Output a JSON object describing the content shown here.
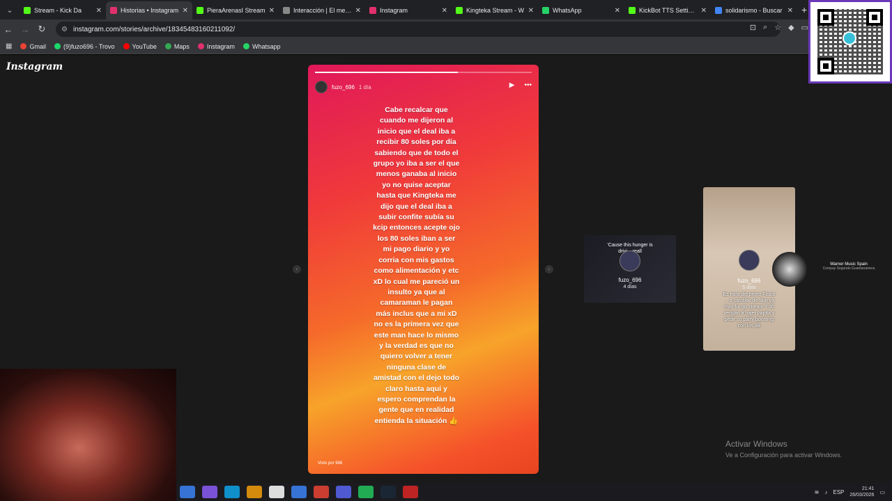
{
  "browser": {
    "tabs": [
      {
        "label": "Stream - Kick Da",
        "color": "#53fc18",
        "active": false
      },
      {
        "label": "Historias • Instagram",
        "color": "#e1306c",
        "active": true
      },
      {
        "label": "PieraArenasI Stream",
        "color": "#53fc18",
        "active": false
      },
      {
        "label": "Interacción | El mejor",
        "color": "#888888",
        "active": false
      },
      {
        "label": "Instagram",
        "color": "#e1306c",
        "active": false
      },
      {
        "label": "Kingteka Stream - W",
        "color": "#53fc18",
        "active": false
      },
      {
        "label": "WhatsApp",
        "color": "#25d366",
        "active": false
      },
      {
        "label": "KickBot TTS Settings",
        "color": "#53fc18",
        "active": false
      },
      {
        "label": "solidarismo - Buscar",
        "color": "#4285f4",
        "active": false
      }
    ],
    "url": "instagram.com/stories/archive/18345483160211092/",
    "bookmarks": [
      {
        "label": "Gmail",
        "color": "#ea4335"
      },
      {
        "label": "(9)fuzo696 - Trovo",
        "color": "#1bd96a"
      },
      {
        "label": "YouTube",
        "color": "#ff0000"
      },
      {
        "label": "Maps",
        "color": "#34a853"
      },
      {
        "label": "Instagram",
        "color": "#e1306c"
      },
      {
        "label": "Whatsapp",
        "color": "#25d366"
      }
    ]
  },
  "page": {
    "logo": "Instagram",
    "story": {
      "progress": 0.66,
      "username": "fuzo_696",
      "time": "1 día",
      "text": "Cabe recalcar que\ncuando me dijeron al\ninicio que el deal iba a\nrecibir 80 soles por día\nsabiendo que de todo el\ngrupo yo iba a ser el que\nmenos ganaba al inicio\nyo no quise aceptar\nhasta que Kingteka me\ndijo que el deal iba a\nsubir confite subía su\nkcip entonces acepte ojo\nlos 80 soles iban a ser\nmi pago diario y yo\ncorria con mis gastos\ncomo alimentación y etc\nxD lo cual me pareció un\ninsulto ya que al\ncamaraman le pagan\nmás inclus que a mi  xD\nno es la primera vez que\neste man hace lo mismo\ny la verdad es que no\nquiero volver a tener\nninguna clase de\namistad con el  dejo todo\nclaro hasta aquí y\nespero comprendan la\ngente que en realidad\nentienda la situación 👍",
      "footer": "Visto por 988"
    },
    "side_stories": [
      {
        "caption": "'Cause this hunger is\ndrivi...  reall",
        "username": "fuzo_696",
        "time": "4 días"
      },
      {
        "caption": "Es hora del primo Fisico\n... a cambiar de skin ya\nmay fur  go stream 7:30\nvengan a hajer papita y\npedir su party boosting\ncon los 3B",
        "username": "fuzo_696",
        "time": "5 días"
      }
    ],
    "music": {
      "title": "Warner Music Spain",
      "subtitle": "Compay Segundo Guantanamera"
    },
    "activation": {
      "title": "Activar Windows",
      "subtitle": "Ve a Configuración para activar Windows."
    }
  },
  "taskbar": {
    "apps": [
      "#3b82f6",
      "#8b5cf6",
      "#0ea5e9",
      "#f59e0b",
      "#ffffff",
      "#3b82f6",
      "#ea4335",
      "#5865f2",
      "#22c55e",
      "#1b2838",
      "#dc2626"
    ],
    "lang": "ESP",
    "time": "21:41",
    "date": "26/03/2026"
  }
}
